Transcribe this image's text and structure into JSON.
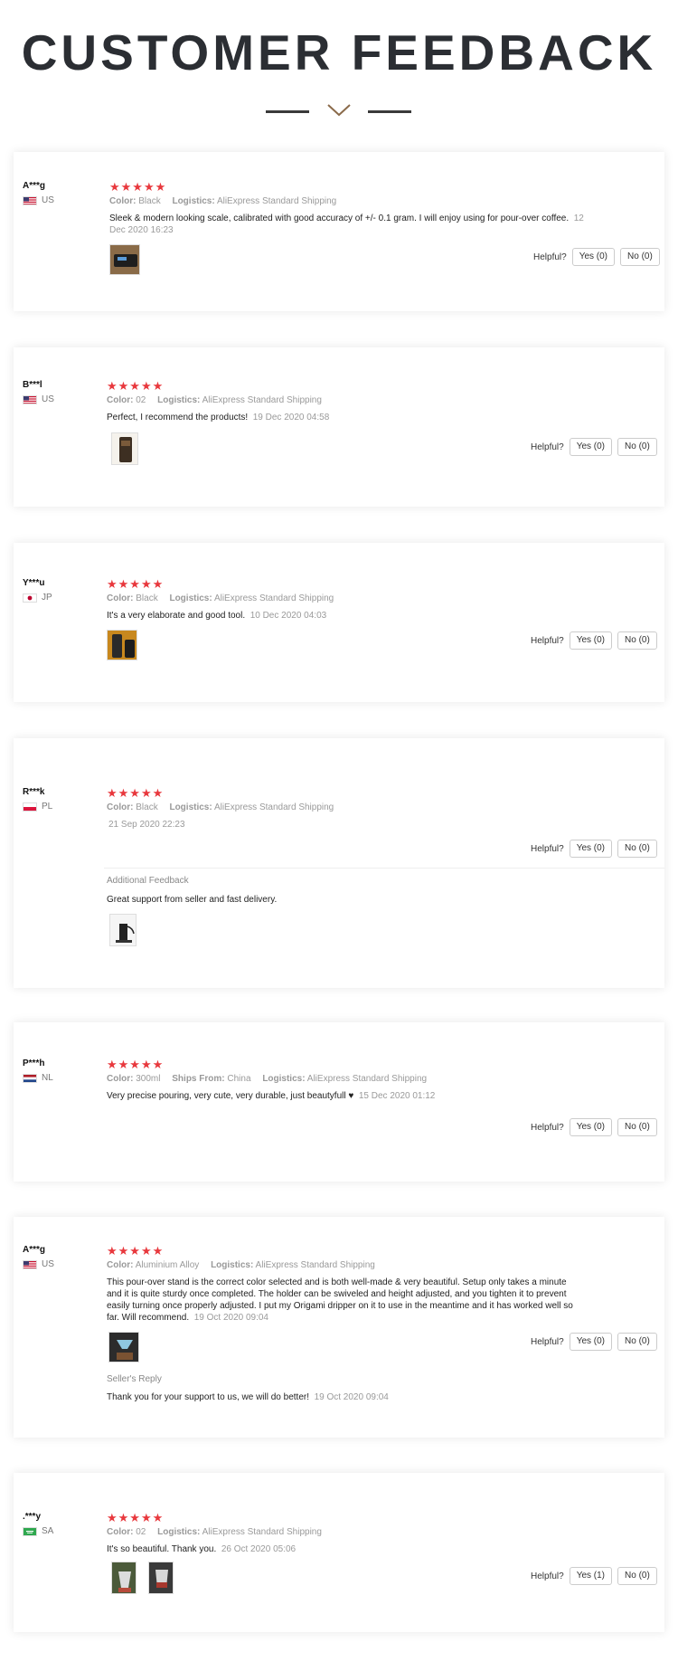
{
  "page": {
    "title": "CUSTOMER FEEDBACK"
  },
  "labels": {
    "color": "Color:",
    "logistics": "Logistics:",
    "ships_from": "Ships From:",
    "helpful": "Helpful?"
  },
  "reviews": [
    {
      "user": "A***g",
      "country": "US",
      "rating": "★★★★★",
      "color": "Black",
      "logistics": "AliExpress Standard Shipping",
      "text": "Sleek & modern looking scale, calibrated with good accuracy of +/- 0.1 gram. I will enjoy using for pour-over coffee.",
      "date": "12 Dec 2020 16:23",
      "yes": "Yes (0)",
      "no": "No (0)"
    },
    {
      "user": "B***l",
      "country": "US",
      "rating": "★★★★★",
      "color": "02",
      "logistics": "AliExpress Standard Shipping",
      "text": "Perfect, I recommend the products!",
      "date": "19 Dec 2020 04:58",
      "yes": "Yes (0)",
      "no": "No (0)"
    },
    {
      "user": "Y***u",
      "country": "JP",
      "rating": "★★★★★",
      "color": "Black",
      "logistics": "AliExpress Standard Shipping",
      "text": "It's a very elaborate and good tool.",
      "date": "10 Dec 2020 04:03",
      "yes": "Yes (0)",
      "no": "No (0)"
    },
    {
      "user": "R***k",
      "country": "PL",
      "rating": "★★★★★",
      "color": "Black",
      "logistics": "AliExpress Standard Shipping",
      "date": "21 Sep 2020 22:23",
      "yes": "Yes (0)",
      "no": "No (0)",
      "additional_title": "Additional Feedback",
      "additional_text": "Great support from seller and fast delivery."
    },
    {
      "user": "P***h",
      "country": "NL",
      "rating": "★★★★★",
      "color": "300ml",
      "ships_from": "China",
      "logistics": "AliExpress Standard Shipping",
      "text": "Very precise pouring, very cute, very durable, just beautyfull ♥",
      "date": "15 Dec 2020 01:12",
      "yes": "Yes (0)",
      "no": "No (0)"
    },
    {
      "user": "A***g",
      "country": "US",
      "rating": "★★★★★",
      "color": "Aluminium Alloy",
      "logistics": "AliExpress Standard Shipping",
      "text_lines": [
        "This pour-over stand is the correct color selected and is both well-made & very beautiful. Setup only takes a minute",
        "and it is quite sturdy once completed. The holder can be swiveled and height adjusted, and you tighten it to prevent",
        "easily turning once properly adjusted. I put my Origami dripper on it to use in the meantime and it has worked well so",
        "far. Will recommend."
      ],
      "date": "19 Oct 2020 09:04",
      "yes": "Yes (0)",
      "no": "No (0)",
      "reply_title": "Seller's Reply",
      "reply_text": "Thank you for your support to us, we will do better!",
      "reply_date": "19 Oct 2020 09:04"
    },
    {
      "user": ".***y",
      "country": "SA",
      "rating": "★★★★★",
      "color": "02",
      "logistics": "AliExpress Standard Shipping",
      "text": "It's so beautiful. Thank you.",
      "date": "26 Oct 2020 05:06",
      "yes": "Yes (1)",
      "no": "No (0)"
    }
  ]
}
